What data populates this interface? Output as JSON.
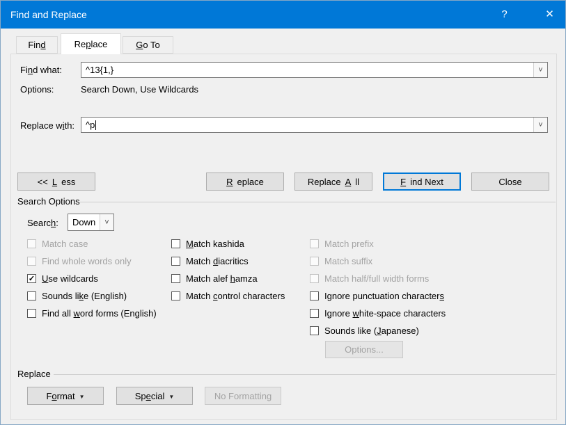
{
  "window": {
    "title": "Find and Replace"
  },
  "icons": {
    "help": "?",
    "close": "✕",
    "combo_arrow": "˅",
    "menu_arrow": "▼",
    "check": "✓"
  },
  "tabs": {
    "find": "Fin&d",
    "replace": "Re&place",
    "goto": "&Go To"
  },
  "find_row": {
    "label": "Fi&nd what:",
    "value": "^13{1,}"
  },
  "options_row": {
    "label": "Options:",
    "value": "Search Down, Use Wildcards"
  },
  "replace_row": {
    "label": "Replace w&ith:",
    "value": "^p"
  },
  "action_buttons": {
    "less": "<< &Less",
    "replace": "&Replace",
    "replace_all": "Replace &All",
    "find_next": "&Find Next",
    "close": "Close"
  },
  "search_options": {
    "group_title": "Search Options",
    "search_label": "Searc&h:",
    "search_value": "Down",
    "col1": [
      {
        "label": "Match case",
        "checked": false,
        "disabled": true
      },
      {
        "label": "Find whole words only",
        "checked": false,
        "disabled": true
      },
      {
        "label": "&Use wildcards",
        "checked": true,
        "disabled": false
      },
      {
        "label": "Sounds li&ke (English)",
        "checked": false,
        "disabled": false
      },
      {
        "label": "Find all &word forms (English)",
        "checked": false,
        "disabled": false
      }
    ],
    "col2": [
      {
        "label": "&Match kashida",
        "checked": false,
        "disabled": false
      },
      {
        "label": "Match &diacritics",
        "checked": false,
        "disabled": false
      },
      {
        "label": "Match alef &hamza",
        "checked": false,
        "disabled": false
      },
      {
        "label": "Match &control characters",
        "checked": false,
        "disabled": false
      }
    ],
    "col3": [
      {
        "label": "Match prefix",
        "checked": false,
        "disabled": true
      },
      {
        "label": "Match suffix",
        "checked": false,
        "disabled": true
      },
      {
        "label": "Match half/full width forms",
        "checked": false,
        "disabled": true
      },
      {
        "label": "Ignore punctuation character&s",
        "checked": false,
        "disabled": false
      },
      {
        "label": "Ignore &white-space characters",
        "checked": false,
        "disabled": false
      },
      {
        "label": "Sounds like (&Japanese)",
        "checked": false,
        "disabled": false
      }
    ],
    "options_button": "Options..."
  },
  "replace_group": {
    "group_title": "Replace",
    "format_button": "F&ormat",
    "special_button": "Sp&ecial",
    "no_formatting_button": "No Formatting"
  }
}
